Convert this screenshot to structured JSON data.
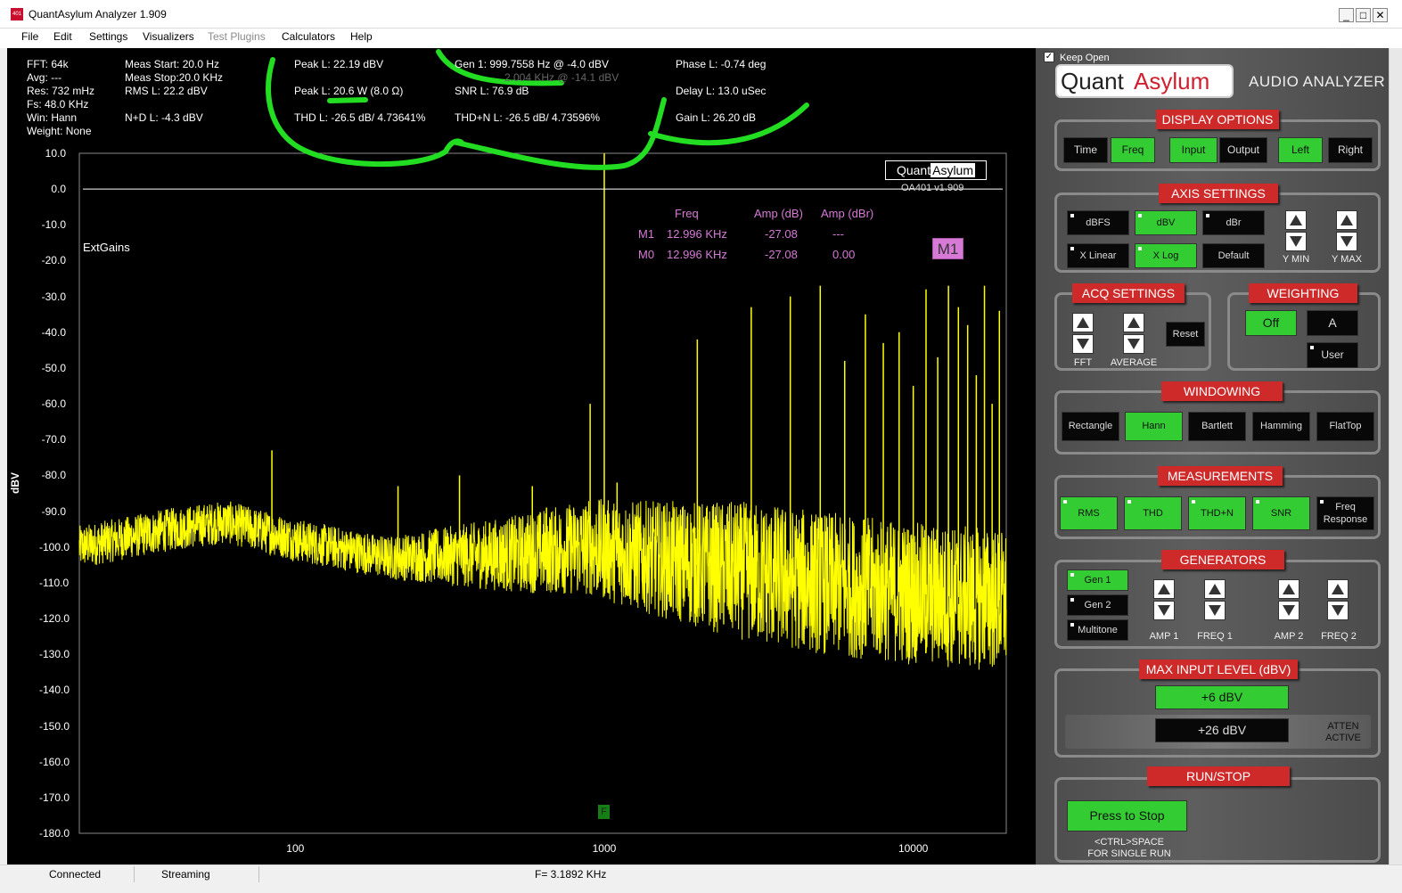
{
  "window": {
    "title": "QuantAsylum Analyzer 1.909",
    "icon_text": "401",
    "min": "_",
    "max": "□",
    "close": "✕"
  },
  "menu": [
    {
      "label": "File",
      "enabled": true
    },
    {
      "label": "Edit",
      "enabled": true
    },
    {
      "label": "Settings",
      "enabled": true
    },
    {
      "label": "Visualizers",
      "enabled": true
    },
    {
      "label": "Test Plugins",
      "enabled": false
    },
    {
      "label": "Calculators",
      "enabled": true
    },
    {
      "label": "Help",
      "enabled": true
    }
  ],
  "stats": {
    "fft": "FFT: 64k",
    "avg": "Avg: ---",
    "res": "Res: 732 mHz",
    "fs": "Fs: 48.0 KHz",
    "win": "Win: Hann",
    "weight": "Weight: None",
    "meas_start": "Meas Start: 20.0 Hz",
    "meas_stop": "Meas Stop:20.0 KHz",
    "rms": "RMS L: 22.2 dBV",
    "nd": "N+D L: -4.3 dBV",
    "peak_dbv": "Peak L: 22.19 dBV",
    "peak_w": "Peak L: 20.6 W (8.0 Ω)",
    "thd": "THD L: -26.5 dB/ 4.73641%",
    "gen1": "Gen 1: 999.7558 Hz @ -4.0  dBV",
    "gen2": "2.004 KHz @ -14.1  dBV",
    "snr": "SNR L: 76.9 dB",
    "thdn": "THD+N L: -26.5 dB/ 4.73596%",
    "phase": "Phase L: -0.74 deg",
    "delay": "Delay L: 13.0 uSec",
    "gain": "Gain L: 26.20 dB"
  },
  "logo_text": {
    "quant": "Quant",
    "asylum": "Asylum",
    "version": "OA401 v1.909"
  },
  "ext_gains": "ExtGains",
  "markers": {
    "headers": {
      "freq": "Freq",
      "amp_db": "Amp (dB)",
      "amp_dbr": "Amp (dBr)"
    },
    "rows": [
      {
        "name": "M1",
        "freq": "12.996 KHz",
        "amp_db": "-27.08",
        "amp_dbr": "---"
      },
      {
        "name": "M0",
        "freq": "12.996 KHz",
        "amp_db": "-27.08",
        "amp_dbr": "0.00"
      }
    ],
    "tag": "M1",
    "f_marker": "F"
  },
  "chart_data": {
    "type": "line",
    "ylabel": "dBV",
    "ylim": [
      -180,
      10
    ],
    "yticks": [
      "10.0",
      "0.0",
      "-10.0",
      "-20.0",
      "-30.0",
      "-40.0",
      "-50.0",
      "-60.0",
      "-70.0",
      "-80.0",
      "-90.0",
      "-100.0",
      "-110.0",
      "-120.0",
      "-130.0",
      "-140.0",
      "-150.0",
      "-160.0",
      "-170.0",
      "-180.0"
    ],
    "xscale": "log",
    "xlim": [
      20,
      20000
    ],
    "xticks": [
      {
        "value": 100,
        "label": "100"
      },
      {
        "value": 1000,
        "label": "1000"
      },
      {
        "value": 10000,
        "label": "10000"
      }
    ],
    "reference_line_db": 0,
    "fundamental_hz": 1000,
    "fundamental_db": 10,
    "spurs": [
      {
        "hz": 84,
        "db": -73
      },
      {
        "hz": 215,
        "db": -83
      },
      {
        "hz": 340,
        "db": -80
      },
      {
        "hz": 585,
        "db": -83
      },
      {
        "hz": 650,
        "db": -89
      },
      {
        "hz": 900,
        "db": -60
      },
      {
        "hz": 1100,
        "db": -82
      },
      {
        "hz": 2000,
        "db": -42
      },
      {
        "hz": 2990,
        "db": -33
      },
      {
        "hz": 4000,
        "db": -30
      },
      {
        "hz": 5000,
        "db": -27
      },
      {
        "hz": 6000,
        "db": -48
      },
      {
        "hz": 7000,
        "db": -35
      },
      {
        "hz": 8000,
        "db": -43
      },
      {
        "hz": 9000,
        "db": -40
      },
      {
        "hz": 10000,
        "db": -55
      },
      {
        "hz": 11000,
        "db": -28
      },
      {
        "hz": 12000,
        "db": -47
      },
      {
        "hz": 13000,
        "db": -27
      },
      {
        "hz": 14000,
        "db": -33
      },
      {
        "hz": 15000,
        "db": -38
      },
      {
        "hz": 16000,
        "db": -52
      },
      {
        "hz": 17000,
        "db": -27
      },
      {
        "hz": 18000,
        "db": -60
      },
      {
        "hz": 19000,
        "db": -34
      }
    ],
    "noise_floor": [
      {
        "hz": 20,
        "db": -100
      },
      {
        "hz": 40,
        "db": -95
      },
      {
        "hz": 60,
        "db": -93
      },
      {
        "hz": 100,
        "db": -98
      },
      {
        "hz": 200,
        "db": -103
      },
      {
        "hz": 500,
        "db": -102
      },
      {
        "hz": 900,
        "db": -100
      },
      {
        "hz": 1200,
        "db": -102
      },
      {
        "hz": 2000,
        "db": -105
      },
      {
        "hz": 3000,
        "db": -107
      },
      {
        "hz": 5000,
        "db": -110
      },
      {
        "hz": 10000,
        "db": -113
      },
      {
        "hz": 20000,
        "db": -115
      }
    ]
  },
  "status": {
    "connected": "Connected",
    "streaming": "Streaming",
    "freq": "F= 3.1892 KHz"
  },
  "panel": {
    "keep_open": "Keep Open",
    "keep_open_checked": "✓",
    "logo_quant": "Quant",
    "logo_asylum": "Asylum",
    "subtitle": "AUDIO ANALYZER",
    "display_options": {
      "title": "DISPLAY OPTIONS",
      "time": "Time",
      "freq": "Freq",
      "input": "Input",
      "output": "Output",
      "left": "Left",
      "right": "Right"
    },
    "axis_settings": {
      "title": "AXIS SETTINGS",
      "dbfs": "dBFS",
      "dbv": "dBV",
      "dbr": "dBr",
      "xlinear": "X Linear",
      "xlog": "X Log",
      "default": "Default",
      "ymin": "Y MIN",
      "ymax": "Y MAX"
    },
    "acq_settings": {
      "title": "ACQ SETTINGS",
      "fft": "FFT",
      "average": "AVERAGE",
      "reset": "Reset"
    },
    "weighting": {
      "title": "WEIGHTING",
      "off": "Off",
      "a": "A",
      "user": "User"
    },
    "windowing": {
      "title": "WINDOWING",
      "rectangle": "Rectangle",
      "hann": "Hann",
      "bartlett": "Bartlett",
      "hamming": "Hamming",
      "flattop": "FlatTop"
    },
    "measurements": {
      "title": "MEASUREMENTS",
      "rms": "RMS",
      "thd": "THD",
      "thdn": "THD+N",
      "snr": "SNR",
      "freq_resp_1": "Freq",
      "freq_resp_2": "Response"
    },
    "generators": {
      "title": "GENERATORS",
      "gen1": "Gen 1",
      "gen2": "Gen 2",
      "multitone": "Multitone",
      "amp1": "AMP 1",
      "freq1": "FREQ 1",
      "amp2": "AMP 2",
      "freq2": "FREQ 2"
    },
    "max_input": {
      "title": "MAX INPUT LEVEL (dBV)",
      "plus6": "+6 dBV",
      "plus26": "+26 dBV",
      "atten1": "ATTEN",
      "atten2": "ACTIVE"
    },
    "run_stop": {
      "title": "RUN/STOP",
      "button": "Press to Stop",
      "hint1": "<CTRL>SPACE",
      "hint2": "FOR SINGLE RUN"
    }
  },
  "colors": {
    "trace": "#ffff00",
    "accent": "#33cc33",
    "header": "#cf2a2a",
    "marker": "#d67ad6",
    "annotation": "#22dd22"
  }
}
